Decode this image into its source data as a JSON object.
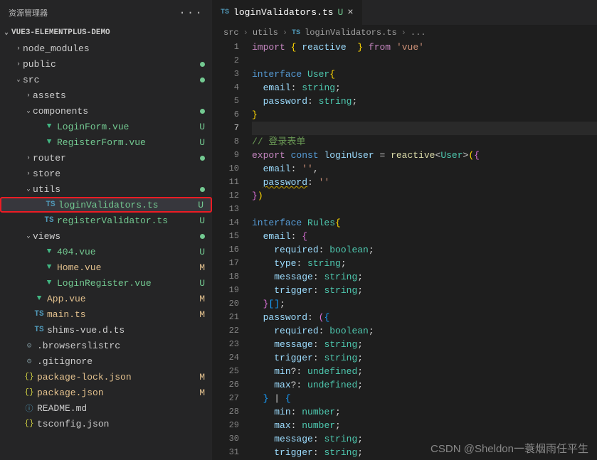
{
  "sidebar": {
    "title": "资源管理器",
    "project": "VUE3-ELEMENTPLUS-DEMO",
    "items": [
      {
        "label": "node_modules",
        "type": "folder",
        "open": false,
        "indent": 1,
        "status": ""
      },
      {
        "label": "public",
        "type": "folder",
        "open": false,
        "indent": 1,
        "status": "dot"
      },
      {
        "label": "src",
        "type": "folder",
        "open": true,
        "indent": 1,
        "status": "dot"
      },
      {
        "label": "assets",
        "type": "folder",
        "open": false,
        "indent": 2,
        "status": ""
      },
      {
        "label": "components",
        "type": "folder",
        "open": true,
        "indent": 2,
        "status": "dot"
      },
      {
        "label": "LoginForm.vue",
        "type": "vue",
        "indent": 3,
        "status": "U",
        "git": "u"
      },
      {
        "label": "RegisterForm.vue",
        "type": "vue",
        "indent": 3,
        "status": "U",
        "git": "u"
      },
      {
        "label": "router",
        "type": "folder",
        "open": false,
        "indent": 2,
        "status": "dot"
      },
      {
        "label": "store",
        "type": "folder",
        "open": false,
        "indent": 2,
        "status": ""
      },
      {
        "label": "utils",
        "type": "folder",
        "open": true,
        "indent": 2,
        "status": "dot"
      },
      {
        "label": "loginValidators.ts",
        "type": "ts",
        "indent": 3,
        "status": "U",
        "git": "u",
        "selected": true,
        "highlight": true
      },
      {
        "label": "registerValidator.ts",
        "type": "ts",
        "indent": 3,
        "status": "U",
        "git": "u"
      },
      {
        "label": "views",
        "type": "folder",
        "open": true,
        "indent": 2,
        "status": "dot"
      },
      {
        "label": "404.vue",
        "type": "vue",
        "indent": 3,
        "status": "U",
        "git": "u"
      },
      {
        "label": "Home.vue",
        "type": "vue",
        "indent": 3,
        "status": "M",
        "git": "m"
      },
      {
        "label": "LoginRegister.vue",
        "type": "vue",
        "indent": 3,
        "status": "U",
        "git": "u"
      },
      {
        "label": "App.vue",
        "type": "vue",
        "indent": 2,
        "status": "M",
        "git": "m"
      },
      {
        "label": "main.ts",
        "type": "ts",
        "indent": 2,
        "status": "M",
        "git": "m"
      },
      {
        "label": "shims-vue.d.ts",
        "type": "ts",
        "indent": 2,
        "status": ""
      },
      {
        "label": ".browserslistrc",
        "type": "conf",
        "indent": 1,
        "status": ""
      },
      {
        "label": ".gitignore",
        "type": "conf",
        "indent": 1,
        "status": ""
      },
      {
        "label": "package-lock.json",
        "type": "json",
        "indent": 1,
        "status": "M",
        "git": "m"
      },
      {
        "label": "package.json",
        "type": "json",
        "indent": 1,
        "status": "M",
        "git": "m"
      },
      {
        "label": "README.md",
        "type": "readme",
        "indent": 1,
        "status": ""
      },
      {
        "label": "tsconfig.json",
        "type": "json",
        "indent": 1,
        "status": ""
      }
    ]
  },
  "tab": {
    "icon": "TS",
    "name": "loginValidators.ts",
    "gitletter": "U",
    "close": "×"
  },
  "breadcrumb": {
    "p1": "src",
    "p2": "utils",
    "p3": "loginValidators.ts",
    "p4": "..."
  },
  "code": {
    "active_line": 7,
    "lines": [
      {
        "n": 1,
        "tokens": [
          [
            "k-purple",
            "import"
          ],
          [
            "k-punc",
            " "
          ],
          [
            "k-yellow",
            "{"
          ],
          [
            "k-punc",
            " "
          ],
          [
            "k-var",
            "reactive"
          ],
          [
            "k-punc",
            "  "
          ],
          [
            "k-yellow",
            "}"
          ],
          [
            "k-punc",
            " "
          ],
          [
            "k-purple",
            "from"
          ],
          [
            "k-punc",
            " "
          ],
          [
            "k-str",
            "'vue'"
          ]
        ]
      },
      {
        "n": 2,
        "tokens": []
      },
      {
        "n": 3,
        "tokens": [
          [
            "k-blue",
            "interface"
          ],
          [
            "k-punc",
            " "
          ],
          [
            "k-type",
            "User"
          ],
          [
            "k-yellow",
            "{"
          ]
        ]
      },
      {
        "n": 4,
        "tokens": [
          [
            "k-punc",
            "  "
          ],
          [
            "k-var",
            "email"
          ],
          [
            "k-punc",
            ": "
          ],
          [
            "k-type",
            "string"
          ],
          [
            "k-punc",
            ";"
          ]
        ]
      },
      {
        "n": 5,
        "tokens": [
          [
            "k-punc",
            "  "
          ],
          [
            "k-var",
            "password"
          ],
          [
            "k-punc",
            ": "
          ],
          [
            "k-type",
            "string"
          ],
          [
            "k-punc",
            ";"
          ]
        ]
      },
      {
        "n": 6,
        "tokens": [
          [
            "k-yellow",
            "}"
          ]
        ]
      },
      {
        "n": 7,
        "tokens": [],
        "active": true
      },
      {
        "n": 8,
        "tokens": [
          [
            "k-comment",
            "// 登录表单"
          ]
        ]
      },
      {
        "n": 9,
        "tokens": [
          [
            "k-purple",
            "export"
          ],
          [
            "k-punc",
            " "
          ],
          [
            "k-blue",
            "const"
          ],
          [
            "k-punc",
            " "
          ],
          [
            "k-var",
            "loginUser"
          ],
          [
            "k-punc",
            " = "
          ],
          [
            "k-func",
            "reactive"
          ],
          [
            "k-punc",
            "<"
          ],
          [
            "k-type",
            "User"
          ],
          [
            "k-punc",
            ">"
          ],
          [
            "k-yellow",
            "("
          ],
          [
            "k-pink",
            "{"
          ]
        ]
      },
      {
        "n": 10,
        "tokens": [
          [
            "k-punc",
            "  "
          ],
          [
            "k-var",
            "email"
          ],
          [
            "k-punc",
            ": "
          ],
          [
            "k-str",
            "''"
          ],
          [
            "k-punc",
            ","
          ]
        ]
      },
      {
        "n": 11,
        "tokens": [
          [
            "k-punc",
            "  "
          ],
          [
            "k-var underline",
            "password"
          ],
          [
            "k-punc",
            ": "
          ],
          [
            "k-str",
            "''"
          ]
        ]
      },
      {
        "n": 12,
        "tokens": [
          [
            "k-pink",
            "}"
          ],
          [
            "k-yellow",
            ")"
          ]
        ]
      },
      {
        "n": 13,
        "tokens": []
      },
      {
        "n": 14,
        "tokens": [
          [
            "k-blue",
            "interface"
          ],
          [
            "k-punc",
            " "
          ],
          [
            "k-type",
            "Rules"
          ],
          [
            "k-yellow",
            "{"
          ]
        ]
      },
      {
        "n": 15,
        "tokens": [
          [
            "k-punc",
            "  "
          ],
          [
            "k-var",
            "email"
          ],
          [
            "k-punc",
            ": "
          ],
          [
            "k-pink",
            "{"
          ]
        ]
      },
      {
        "n": 16,
        "tokens": [
          [
            "k-punc",
            "    "
          ],
          [
            "k-var",
            "required"
          ],
          [
            "k-punc",
            ": "
          ],
          [
            "k-type",
            "boolean"
          ],
          [
            "k-punc",
            ";"
          ]
        ]
      },
      {
        "n": 17,
        "tokens": [
          [
            "k-punc",
            "    "
          ],
          [
            "k-var",
            "type"
          ],
          [
            "k-punc",
            ": "
          ],
          [
            "k-type",
            "string"
          ],
          [
            "k-punc",
            ";"
          ]
        ]
      },
      {
        "n": 18,
        "tokens": [
          [
            "k-punc",
            "    "
          ],
          [
            "k-var",
            "message"
          ],
          [
            "k-punc",
            ": "
          ],
          [
            "k-type",
            "string"
          ],
          [
            "k-punc",
            ";"
          ]
        ]
      },
      {
        "n": 19,
        "tokens": [
          [
            "k-punc",
            "    "
          ],
          [
            "k-var",
            "trigger"
          ],
          [
            "k-punc",
            ": "
          ],
          [
            "k-type",
            "string"
          ],
          [
            "k-punc",
            ";"
          ]
        ]
      },
      {
        "n": 20,
        "tokens": [
          [
            "k-punc",
            "  "
          ],
          [
            "k-pink",
            "}"
          ],
          [
            "k-cyan",
            "[]"
          ],
          [
            "k-punc",
            ";"
          ]
        ]
      },
      {
        "n": 21,
        "tokens": [
          [
            "k-punc",
            "  "
          ],
          [
            "k-var",
            "password"
          ],
          [
            "k-punc",
            ": "
          ],
          [
            "k-pink",
            "("
          ],
          [
            "k-cyan",
            "{"
          ]
        ]
      },
      {
        "n": 22,
        "tokens": [
          [
            "k-punc",
            "    "
          ],
          [
            "k-var",
            "required"
          ],
          [
            "k-punc",
            ": "
          ],
          [
            "k-type",
            "boolean"
          ],
          [
            "k-punc",
            ";"
          ]
        ]
      },
      {
        "n": 23,
        "tokens": [
          [
            "k-punc",
            "    "
          ],
          [
            "k-var",
            "message"
          ],
          [
            "k-punc",
            ": "
          ],
          [
            "k-type",
            "string"
          ],
          [
            "k-punc",
            ";"
          ]
        ]
      },
      {
        "n": 24,
        "tokens": [
          [
            "k-punc",
            "    "
          ],
          [
            "k-var",
            "trigger"
          ],
          [
            "k-punc",
            ": "
          ],
          [
            "k-type",
            "string"
          ],
          [
            "k-punc",
            ";"
          ]
        ]
      },
      {
        "n": 25,
        "tokens": [
          [
            "k-punc",
            "    "
          ],
          [
            "k-var",
            "min"
          ],
          [
            "k-punc",
            "?: "
          ],
          [
            "k-type",
            "undefined"
          ],
          [
            "k-punc",
            ";"
          ]
        ]
      },
      {
        "n": 26,
        "tokens": [
          [
            "k-punc",
            "    "
          ],
          [
            "k-var",
            "max"
          ],
          [
            "k-punc",
            "?: "
          ],
          [
            "k-type",
            "undefined"
          ],
          [
            "k-punc",
            ";"
          ]
        ]
      },
      {
        "n": 27,
        "tokens": [
          [
            "k-punc",
            "  "
          ],
          [
            "k-cyan",
            "}"
          ],
          [
            "k-punc",
            " | "
          ],
          [
            "k-cyan",
            "{"
          ]
        ]
      },
      {
        "n": 28,
        "tokens": [
          [
            "k-punc",
            "    "
          ],
          [
            "k-var",
            "min"
          ],
          [
            "k-punc",
            ": "
          ],
          [
            "k-type",
            "number"
          ],
          [
            "k-punc",
            ";"
          ]
        ]
      },
      {
        "n": 29,
        "tokens": [
          [
            "k-punc",
            "    "
          ],
          [
            "k-var",
            "max"
          ],
          [
            "k-punc",
            ": "
          ],
          [
            "k-type",
            "number"
          ],
          [
            "k-punc",
            ";"
          ]
        ]
      },
      {
        "n": 30,
        "tokens": [
          [
            "k-punc",
            "    "
          ],
          [
            "k-var",
            "message"
          ],
          [
            "k-punc",
            ": "
          ],
          [
            "k-type",
            "string"
          ],
          [
            "k-punc",
            ";"
          ]
        ]
      },
      {
        "n": 31,
        "tokens": [
          [
            "k-punc",
            "    "
          ],
          [
            "k-var",
            "trigger"
          ],
          [
            "k-punc",
            ": "
          ],
          [
            "k-type",
            "string"
          ],
          [
            "k-punc",
            ";"
          ]
        ]
      }
    ]
  },
  "watermark": "CSDN @Sheldon一蓑烟雨任平生"
}
